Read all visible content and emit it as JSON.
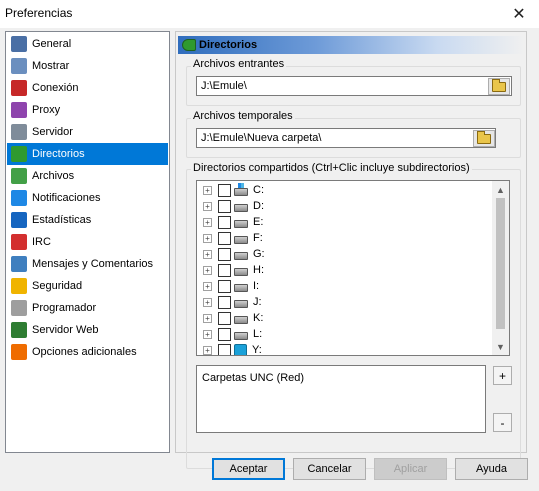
{
  "window": {
    "title": "Preferencias",
    "close_glyph": "✕"
  },
  "nav": {
    "items": [
      {
        "label": "General",
        "icon": "general-icon",
        "color": "#4a6fa5"
      },
      {
        "label": "Mostrar",
        "icon": "display-icon",
        "color": "#6b8fbf"
      },
      {
        "label": "Conexión",
        "icon": "connection-icon",
        "color": "#c62828"
      },
      {
        "label": "Proxy",
        "icon": "proxy-icon",
        "color": "#8e44ad"
      },
      {
        "label": "Servidor",
        "icon": "server-icon",
        "color": "#7f8c9a"
      },
      {
        "label": "Directorios",
        "icon": "folders-icon",
        "color": "#2f9a2f",
        "selected": true
      },
      {
        "label": "Archivos",
        "icon": "files-icon",
        "color": "#43a047"
      },
      {
        "label": "Notificaciones",
        "icon": "notifications-icon",
        "color": "#1e88e5"
      },
      {
        "label": "Estadísticas",
        "icon": "statistics-icon",
        "color": "#1565c0"
      },
      {
        "label": "IRC",
        "icon": "irc-icon",
        "color": "#d32f2f"
      },
      {
        "label": "Mensajes y Comentarios",
        "icon": "messages-icon",
        "color": "#3f7fbf"
      },
      {
        "label": "Seguridad",
        "icon": "security-icon",
        "color": "#f0b400"
      },
      {
        "label": "Programador",
        "icon": "scheduler-icon",
        "color": "#9e9e9e"
      },
      {
        "label": "Servidor Web",
        "icon": "web-server-icon",
        "color": "#2e7d32"
      },
      {
        "label": "Opciones adicionales",
        "icon": "advanced-options-icon",
        "color": "#ef6c00"
      }
    ]
  },
  "panel": {
    "title": "Directorios",
    "incoming": {
      "label": "Archivos entrantes",
      "value": "J:\\Emule\\"
    },
    "temp": {
      "label": "Archivos temporales",
      "value": "J:\\Emule\\Nueva carpeta\\"
    },
    "shared": {
      "label": "Directorios compartidos (Ctrl+Clic incluye subdirectorios)",
      "drives": [
        {
          "letter": "C:",
          "type": "sys"
        },
        {
          "letter": "D:",
          "type": "disk"
        },
        {
          "letter": "E:",
          "type": "disk"
        },
        {
          "letter": "F:",
          "type": "disk"
        },
        {
          "letter": "G:",
          "type": "disk"
        },
        {
          "letter": "H:",
          "type": "disk"
        },
        {
          "letter": "I:",
          "type": "disk"
        },
        {
          "letter": "J:",
          "type": "disk"
        },
        {
          "letter": "K:",
          "type": "disk"
        },
        {
          "letter": "L:",
          "type": "disk"
        },
        {
          "letter": "Y:",
          "type": "net"
        }
      ]
    },
    "unc": {
      "label": "Carpetas UNC (Red)",
      "add_glyph": "+",
      "remove_glyph": "-"
    }
  },
  "buttons": {
    "accept": "Aceptar",
    "cancel": "Cancelar",
    "apply": "Aplicar",
    "help": "Ayuda"
  },
  "colors": {
    "selection": "#0078d7",
    "header_blue": "#2f6dbd"
  }
}
